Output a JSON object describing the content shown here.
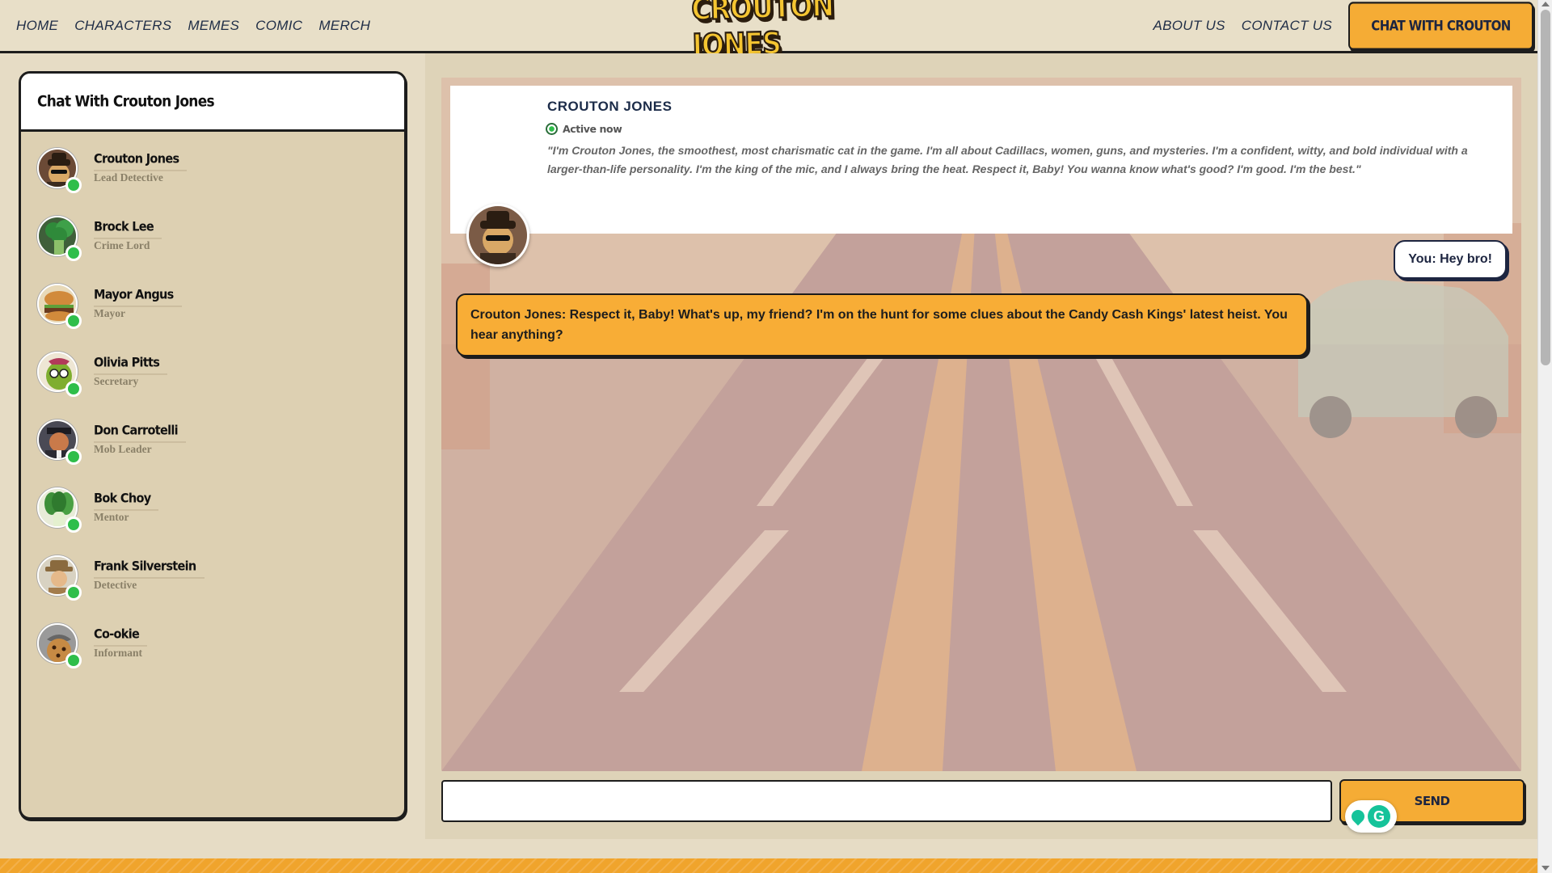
{
  "nav": {
    "left": [
      "HOME",
      "CHARACTERS",
      "MEMES",
      "COMIC",
      "MERCH"
    ],
    "right": [
      "ABOUT US",
      "CONTACT US"
    ],
    "logo_text": "CROUTON JONES",
    "cta_label": "CHAT WITH CROUTON"
  },
  "sidebar": {
    "title": "Chat With Crouton Jones",
    "characters": [
      {
        "name": "Crouton Jones",
        "role": "Lead Detective"
      },
      {
        "name": "Brock Lee",
        "role": "Crime Lord"
      },
      {
        "name": "Mayor Angus",
        "role": "Mayor"
      },
      {
        "name": "Olivia Pitts",
        "role": "Secretary"
      },
      {
        "name": "Don Carrotelli",
        "role": "Mob Leader"
      },
      {
        "name": "Bok Choy",
        "role": "Mentor"
      },
      {
        "name": "Frank Silverstein",
        "role": "Detective"
      },
      {
        "name": "Co-okie",
        "role": "Informant"
      }
    ]
  },
  "chat": {
    "profile_name": "CROUTON JONES",
    "status": "Active now",
    "bio": "\"I'm Crouton Jones, the smoothest, most charismatic cat in the game. I'm all about Cadillacs, women, guns, and mysteries. I'm a confident, witty, and bold individual with a larger-than-life personality. I'm the king of the mic, and I always bring the heat. Respect it, Baby! You wanna know what's good? I'm good. I'm the best.\"",
    "messages": [
      {
        "sender": "user",
        "text": "You: Hey bro!"
      },
      {
        "sender": "bot",
        "text": "Crouton Jones: Respect it, Baby! What's up, my friend? I'm on the hunt for some clues about the Candy Cash Kings' latest heist. You hear anything?"
      }
    ],
    "input_value": "",
    "send_label": "SEND"
  },
  "colors": {
    "accent_orange": "#f5ac35",
    "navy": "#1d2540",
    "online_green": "#2fbe4a",
    "page_bg": "#e6dcc5"
  }
}
